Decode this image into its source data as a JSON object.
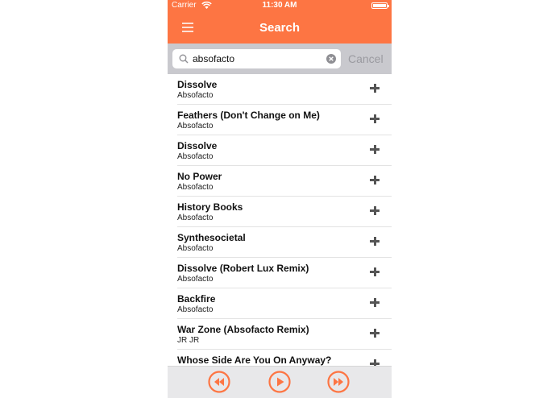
{
  "status_bar": {
    "carrier": "Carrier",
    "time": "11:30 AM"
  },
  "nav": {
    "title": "Search"
  },
  "search": {
    "value": "absofacto",
    "cancel_label": "Cancel"
  },
  "results": [
    {
      "title": "Dissolve",
      "artist": "Absofacto"
    },
    {
      "title": "Feathers (Don't Change on Me)",
      "artist": "Absofacto"
    },
    {
      "title": "Dissolve",
      "artist": "Absofacto"
    },
    {
      "title": "No Power",
      "artist": "Absofacto"
    },
    {
      "title": "History Books",
      "artist": "Absofacto"
    },
    {
      "title": "Synthesocietal",
      "artist": "Absofacto"
    },
    {
      "title": "Dissolve (Robert Lux Remix)",
      "artist": "Absofacto"
    },
    {
      "title": "Backfire",
      "artist": "Absofacto"
    },
    {
      "title": "War Zone (Absofacto Remix)",
      "artist": "JR JR"
    },
    {
      "title": "Whose Side Are You On Anyway?",
      "artist": ""
    }
  ],
  "player": {
    "controls": [
      "rewind-icon",
      "play-icon",
      "fast-forward-icon"
    ]
  },
  "colors": {
    "accent": "#fd7543",
    "searchbar": "#c9c9ce"
  }
}
